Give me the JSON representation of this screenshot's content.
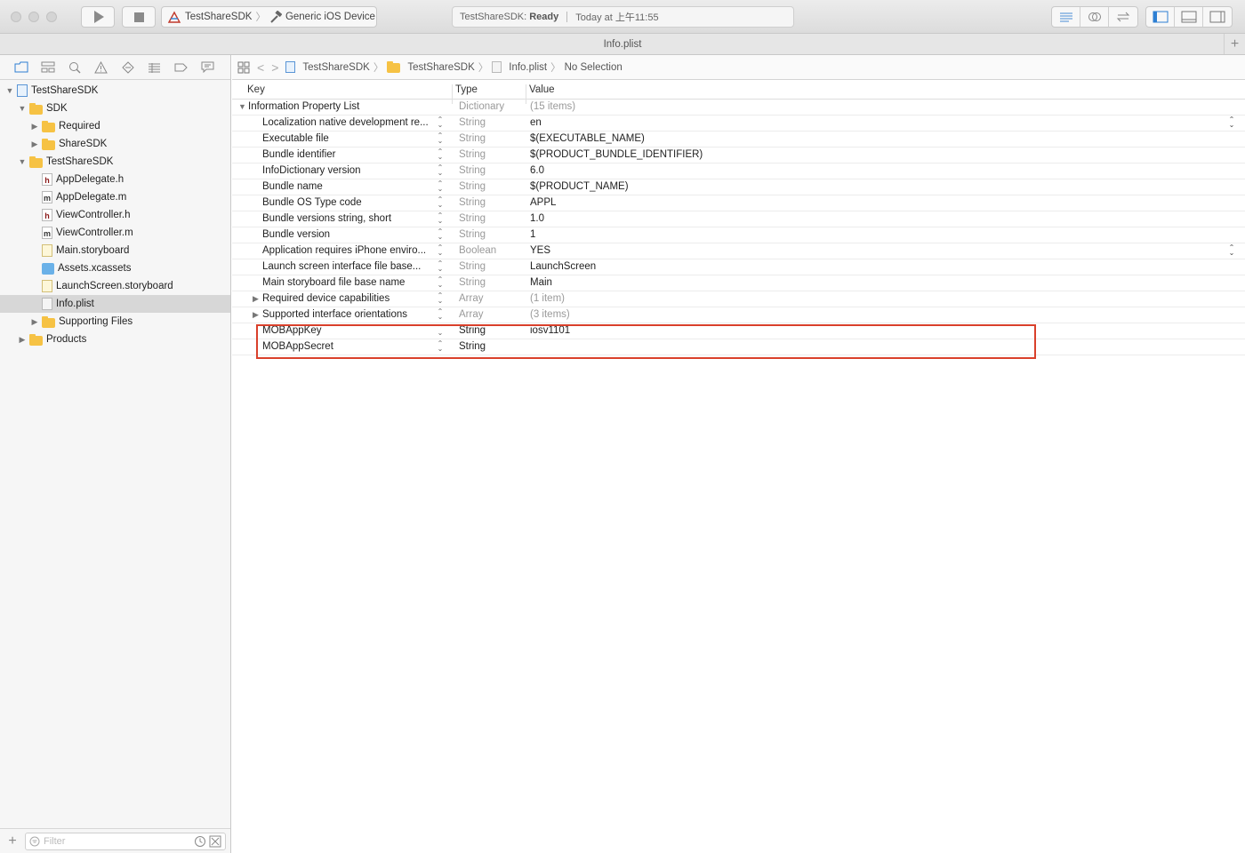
{
  "toolbar": {
    "scheme_name": "TestShareSDK",
    "device_name": "Generic iOS Device",
    "status_project": "TestShareSDK:",
    "status_state": "Ready",
    "status_time": "Today at 上午11:55"
  },
  "tab": {
    "title": "Info.plist"
  },
  "navigator": {
    "tree": [
      {
        "label": "TestShareSDK",
        "icon": "project-icon",
        "depth": 0,
        "disclosure": "open"
      },
      {
        "label": "SDK",
        "icon": "folder-icon",
        "depth": 1,
        "disclosure": "open"
      },
      {
        "label": "Required",
        "icon": "folder-icon",
        "depth": 2,
        "disclosure": "closed"
      },
      {
        "label": "ShareSDK",
        "icon": "folder-icon",
        "depth": 2,
        "disclosure": "closed"
      },
      {
        "label": "TestShareSDK",
        "icon": "folder-icon",
        "depth": 1,
        "disclosure": "open"
      },
      {
        "label": "AppDelegate.h",
        "icon": "header-file-icon",
        "depth": 2,
        "disclosure": "none"
      },
      {
        "label": "AppDelegate.m",
        "icon": "source-file-icon",
        "depth": 2,
        "disclosure": "none"
      },
      {
        "label": "ViewController.h",
        "icon": "header-file-icon",
        "depth": 2,
        "disclosure": "none"
      },
      {
        "label": "ViewController.m",
        "icon": "source-file-icon",
        "depth": 2,
        "disclosure": "none"
      },
      {
        "label": "Main.storyboard",
        "icon": "storyboard-file-icon",
        "depth": 2,
        "disclosure": "none"
      },
      {
        "label": "Assets.xcassets",
        "icon": "asset-catalog-icon",
        "depth": 2,
        "disclosure": "none"
      },
      {
        "label": "LaunchScreen.storyboard",
        "icon": "storyboard-file-icon",
        "depth": 2,
        "disclosure": "none"
      },
      {
        "label": "Info.plist",
        "icon": "plist-file-icon",
        "depth": 2,
        "disclosure": "none",
        "selected": true
      },
      {
        "label": "Supporting Files",
        "icon": "folder-icon",
        "depth": 2,
        "disclosure": "closed"
      },
      {
        "label": "Products",
        "icon": "folder-icon",
        "depth": 1,
        "disclosure": "closed"
      }
    ],
    "filter_placeholder": "Filter"
  },
  "jumpbar": {
    "crumbs": [
      "TestShareSDK",
      "TestShareSDK",
      "Info.plist",
      "No Selection"
    ]
  },
  "plist": {
    "columns": {
      "key": "Key",
      "type": "Type",
      "value": "Value"
    },
    "root": {
      "key": "Information Property List",
      "type": "Dictionary",
      "value": "(15 items)"
    },
    "rows": [
      {
        "key": "Localization native development re...",
        "type": "String",
        "value": "en",
        "value_stepper": true
      },
      {
        "key": "Executable file",
        "type": "String",
        "value": "$(EXECUTABLE_NAME)"
      },
      {
        "key": "Bundle identifier",
        "type": "String",
        "value": "$(PRODUCT_BUNDLE_IDENTIFIER)"
      },
      {
        "key": "InfoDictionary version",
        "type": "String",
        "value": "6.0"
      },
      {
        "key": "Bundle name",
        "type": "String",
        "value": "$(PRODUCT_NAME)"
      },
      {
        "key": "Bundle OS Type code",
        "type": "String",
        "value": "APPL"
      },
      {
        "key": "Bundle versions string, short",
        "type": "String",
        "value": "1.0"
      },
      {
        "key": "Bundle version",
        "type": "String",
        "value": "1"
      },
      {
        "key": "Application requires iPhone enviro...",
        "type": "Boolean",
        "value": "YES",
        "value_stepper": true
      },
      {
        "key": "Launch screen interface file base...",
        "type": "String",
        "value": "LaunchScreen"
      },
      {
        "key": "Main storyboard file base name",
        "type": "String",
        "value": "Main"
      },
      {
        "key": "Required device capabilities",
        "type": "Array",
        "value": "(1 item)",
        "collapsible": true
      },
      {
        "key": "Supported interface orientations",
        "type": "Array",
        "value": "(3 items)",
        "collapsible": true
      },
      {
        "key": "MOBAppKey",
        "type": "String",
        "value": "iosv1101",
        "highlighted": true
      },
      {
        "key": "MOBAppSecret",
        "type": "String",
        "value": "",
        "highlighted": true
      }
    ]
  },
  "colors": {
    "highlight_border": "#d9402b",
    "folder": "#f6c244",
    "selection": "#d7d7d7"
  }
}
